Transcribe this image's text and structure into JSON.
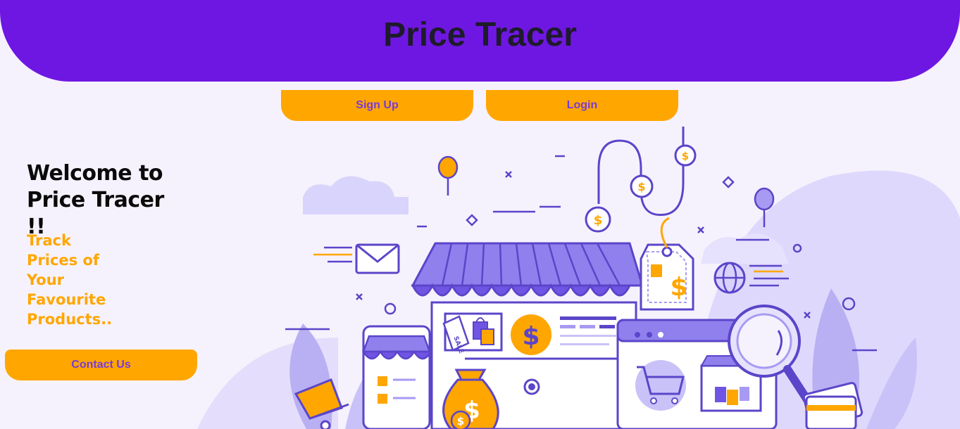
{
  "header": {
    "title": "Price Tracer"
  },
  "auth": {
    "signup_label": "Sign Up",
    "login_label": "Login"
  },
  "hero": {
    "heading": "Welcome to Price Tracer !!",
    "tagline": "Track Prices of Your Favourite Products..",
    "contact_label": "Contact Us"
  },
  "illustration": {
    "sale_tag": "SALE",
    "currency_symbol": "$"
  },
  "colors": {
    "header": "#6f17e2",
    "accent": "#ffa600",
    "button_text": "#7a3bd6",
    "background": "#f6f2fd",
    "illustration_purple": "#5b45c9"
  }
}
